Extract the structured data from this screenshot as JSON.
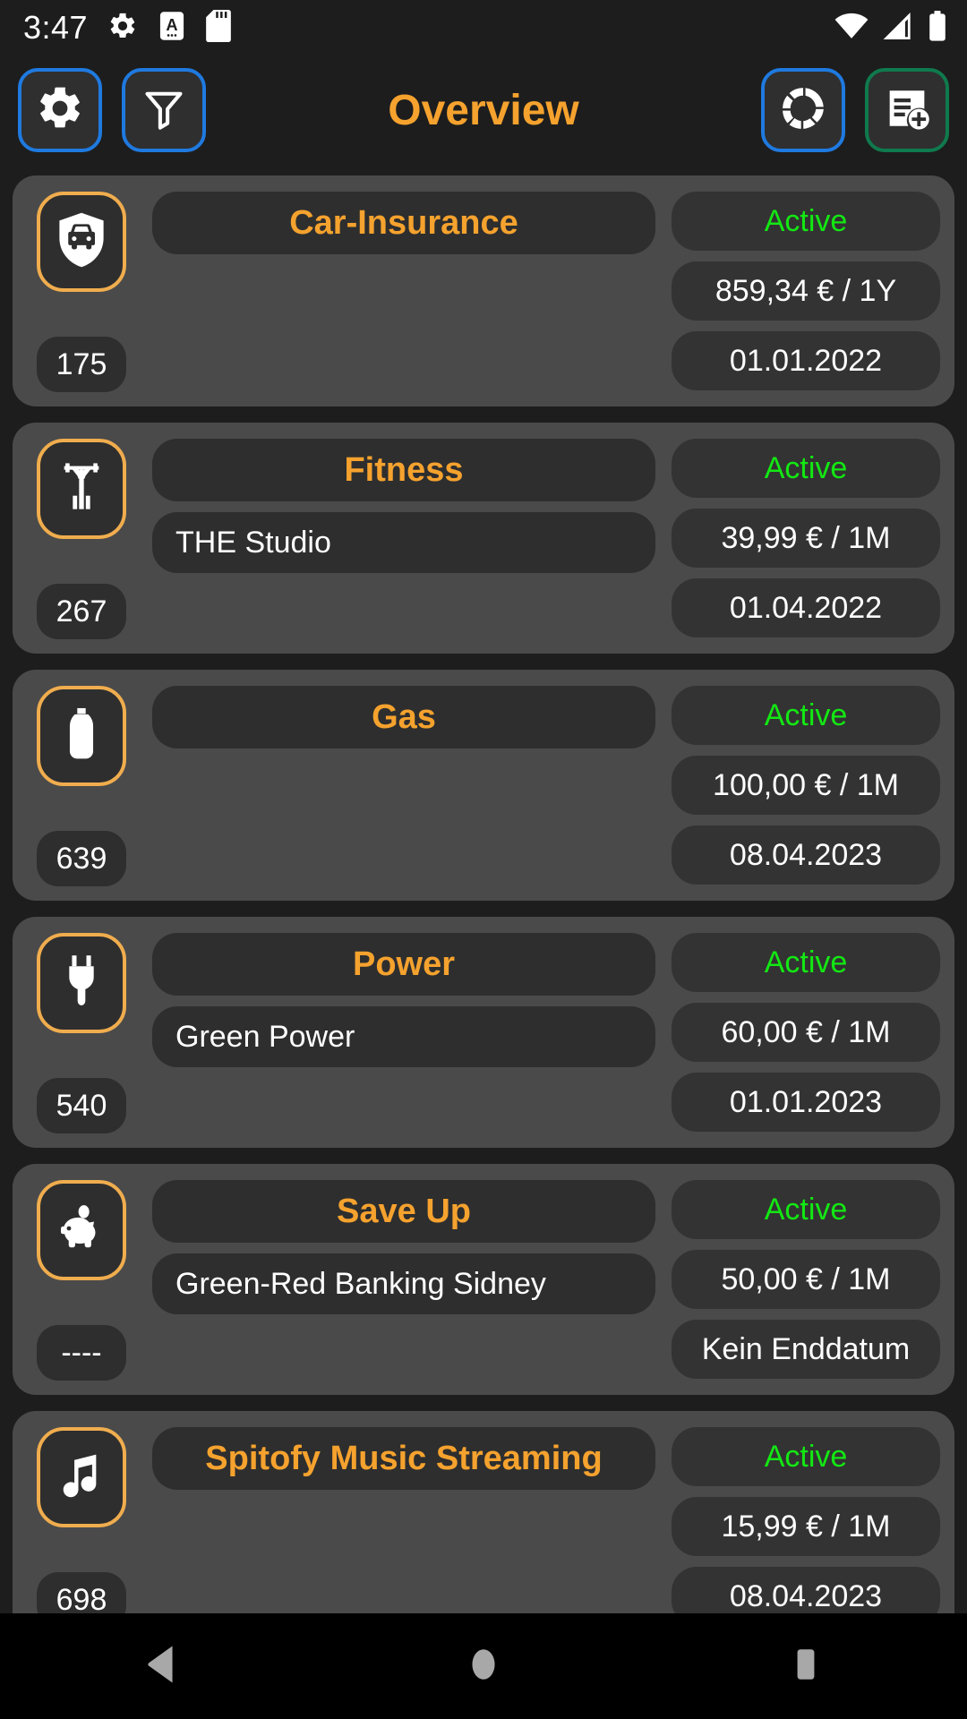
{
  "status_bar": {
    "time": "3:47",
    "left_icons": [
      "gear-icon",
      "a-letter-icon",
      "sd-card-icon"
    ],
    "right_icons": [
      "wifi-icon",
      "cell-signal-icon",
      "battery-icon"
    ]
  },
  "app_bar": {
    "title": "Overview",
    "title_color": "#f5a22e",
    "left_buttons": [
      {
        "name": "settings-button",
        "icon": "gear-icon",
        "border_color": "#1f7ae0"
      },
      {
        "name": "filter-button",
        "icon": "funnel-icon",
        "border_color": "#1f7ae0"
      }
    ],
    "right_buttons": [
      {
        "name": "statistics-button",
        "icon": "donut-chart-icon",
        "border_color": "#1f7ae0"
      },
      {
        "name": "add-contract-button",
        "icon": "document-add-icon",
        "border_color": "#0f7a4d"
      }
    ]
  },
  "colors": {
    "accent": "#f5a22e",
    "active_green": "#13e813",
    "card_bg": "#4a4a4a",
    "pill_bg": "#2e2e2e",
    "right_pill_bg": "#333333",
    "icon_border": "#f0ad4e",
    "screen_bg": "#1d1d1d"
  },
  "contracts": [
    {
      "id": "175",
      "icon": "car-shield-icon",
      "title": "Car-Insurance",
      "provider": "",
      "status": "Active",
      "cost": "859,34 € / 1Y",
      "date": "01.01.2022"
    },
    {
      "id": "267",
      "icon": "weightlifter-icon",
      "title": "Fitness",
      "provider": "THE Studio",
      "status": "Active",
      "cost": "39,99 € / 1M",
      "date": "01.04.2022"
    },
    {
      "id": "639",
      "icon": "gas-bottle-icon",
      "title": "Gas",
      "provider": "",
      "status": "Active",
      "cost": "100,00 € / 1M",
      "date": "08.04.2023"
    },
    {
      "id": "540",
      "icon": "power-plug-icon",
      "title": "Power",
      "provider": "Green Power",
      "status": "Active",
      "cost": "60,00 € / 1M",
      "date": "01.01.2023"
    },
    {
      "id": "----",
      "icon": "piggy-bank-icon",
      "title": "Save Up",
      "provider": "Green-Red Banking Sidney",
      "status": "Active",
      "cost": "50,00 € / 1M",
      "date": "Kein Enddatum"
    },
    {
      "id": "698",
      "icon": "music-note-icon",
      "title": "Spitofy Music Streaming",
      "provider": "",
      "status": "Active",
      "cost": "15,99 € / 1M",
      "date": "08.04.2023"
    }
  ],
  "nav_bar": {
    "buttons": [
      "back-button",
      "home-button",
      "recents-button"
    ]
  }
}
